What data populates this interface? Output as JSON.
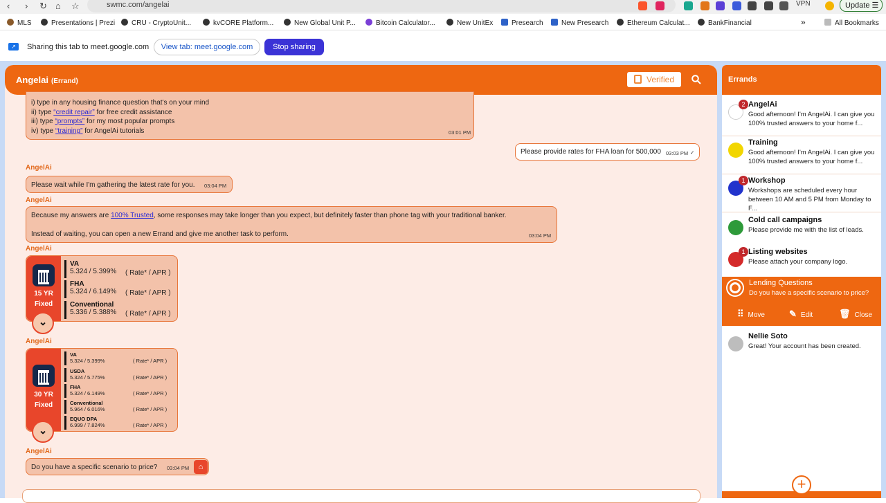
{
  "browser": {
    "url": "swmc.com/angelai",
    "vpn_label": "VPN",
    "update_label": "Update",
    "bookmarks": [
      "MLS",
      "Presentations | Prezi",
      "CRU - CryptoUnit...",
      "kvCORE Platform...",
      "New Global Unit P...",
      "Bitcoin Calculator...",
      "New UnitEx",
      "Presearch",
      "New Presearch",
      "Ethereum Calculat...",
      "BankFinancial"
    ],
    "all_bookmarks": "All Bookmarks"
  },
  "share": {
    "text": "Sharing this tab to meet.google.com",
    "view_tab": "View tab: meet.google.com",
    "stop": "Stop sharing"
  },
  "chat": {
    "title": "Angelai",
    "subtitle": "(Errand)",
    "verified": "Verified",
    "intro_lines": [
      "i) type in any housing finance question that's on your mind",
      "for free credit assistance",
      "for my most popular prompts",
      "for AngelAi tutorials"
    ],
    "intro_prefix": [
      "ii) type",
      "iii) type",
      "iv) type"
    ],
    "intro_links": [
      "“credit repair”",
      "“prompts”",
      "“training”"
    ],
    "intro_time": "03:01 PM",
    "user_msg": "Please provide rates for FHA loan for 500,000",
    "user_time": "03:03 PM",
    "sender": "AngelAi",
    "wait_msg": "Please wait while I'm gathering the latest rate for you.",
    "wait_time": "03:04 PM",
    "trust_pre": "Because my answers are",
    "trust_link": "100% Trusted",
    "trust_post": ", some responses may take longer than you expect, but definitely faster than phone tag with your traditional banker.",
    "trust_line2": "Instead of waiting, you can open a new Errand and give me another task to perform.",
    "trust_time": "03:04 PM",
    "card15": {
      "term": "15 YR",
      "type": "Fixed",
      "rows": [
        {
          "name": "VA",
          "rate": "5.324 / 5.399%",
          "label": "( Rate* / APR )"
        },
        {
          "name": "FHA",
          "rate": "5.324 / 6.149%",
          "label": "( Rate* / APR )"
        },
        {
          "name": "Conventional",
          "rate": "5.336 / 5.388%",
          "label": "( Rate* / APR )"
        }
      ]
    },
    "card30": {
      "term": "30 YR",
      "type": "Fixed",
      "rows": [
        {
          "name": "VA",
          "rate": "5.324 / 5.399%",
          "label": "( Rate* / APR )"
        },
        {
          "name": "USDA",
          "rate": "5.324 / 5.775%",
          "label": "( Rate* / APR )"
        },
        {
          "name": "FHA",
          "rate": "5.324 / 6.149%",
          "label": "( Rate* / APR )"
        },
        {
          "name": "Conventional",
          "rate": "5.964 / 6.016%",
          "label": "( Rate* / APR )"
        },
        {
          "name": "EQUO DPA",
          "rate": "6.999 / 7.824%",
          "label": "( Rate* / APR )"
        }
      ]
    },
    "scenario_msg": "Do you have a specific scenario to price?",
    "scenario_time": "03:04 PM"
  },
  "errands": {
    "title": "Errands",
    "items": [
      {
        "name": "AngelAi",
        "preview": "Good afternoon! I'm AngelAi. I can give you 100% trusted answers to your home f...",
        "badge": "2",
        "color": "#ffffff"
      },
      {
        "name": "Training",
        "preview": "Good afternoon! I'm AngelAi. I can give you 100% trusted answers to your home f...",
        "badge": "",
        "color": "#f2d600"
      },
      {
        "name": "Workshop",
        "preview": "Workshops are scheduled every hour between 10 AM and 5 PM from Monday to F...",
        "badge": "1",
        "color": "#2233cc"
      },
      {
        "name": "Cold call campaigns",
        "preview": "Please provide me with the list of leads.",
        "badge": "",
        "color": "#2e9a3a"
      },
      {
        "name": "Listing websites",
        "preview": "Please attach your company logo.",
        "badge": "1",
        "color": "#d42a2a"
      }
    ],
    "selected": {
      "name": "Lending Questions",
      "preview": "Do you have a specific scenario to price?"
    },
    "actions": {
      "move": "Move",
      "edit": "Edit",
      "close": "Close"
    },
    "last": {
      "name": "Nellie Soto",
      "preview": "Great! Your account has been created."
    }
  }
}
